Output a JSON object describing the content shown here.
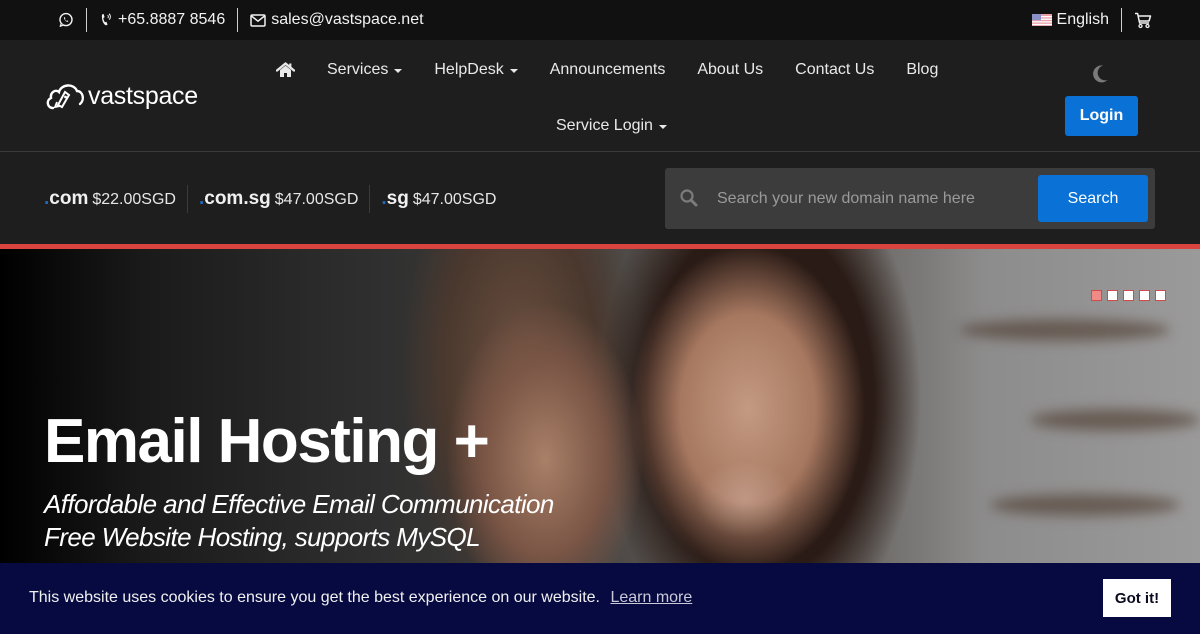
{
  "topbar": {
    "whatsapp_icon": "whatsapp-icon",
    "phone_icon": "phone-volume-icon",
    "phone": "+65.8887 8546",
    "email_icon": "envelope-icon",
    "email": "sales@vastspace.net",
    "language": "English",
    "flag_icon": "us-flag-icon",
    "cart_icon": "shopping-cart-icon"
  },
  "header": {
    "logo_text": "vastspace",
    "logo_icon": "cloud-rocket-icon",
    "nav": [
      {
        "label": "",
        "icon": "home-icon",
        "dropdown": false
      },
      {
        "label": "Services",
        "dropdown": true
      },
      {
        "label": "HelpDesk",
        "dropdown": true
      },
      {
        "label": "Announcements",
        "dropdown": false
      },
      {
        "label": "About Us",
        "dropdown": false
      },
      {
        "label": "Contact Us",
        "dropdown": false
      },
      {
        "label": "Blog",
        "dropdown": false
      },
      {
        "label": "Service Login",
        "dropdown": true
      }
    ],
    "theme_icon": "moon-icon",
    "login_label": "Login"
  },
  "domain": {
    "prices": [
      {
        "tld": "com",
        "price": "$22.00SGD"
      },
      {
        "tld": "com.sg",
        "price": "$47.00SGD"
      },
      {
        "tld": "sg",
        "price": "$47.00SGD"
      }
    ],
    "search_placeholder": "Search your new domain name here",
    "search_value": "",
    "search_label": "Search"
  },
  "hero": {
    "title": "Email Hosting +",
    "subtitle_line1": "Affordable and Effective Email Communication",
    "subtitle_line2": "Free Website Hosting, supports MySQL",
    "slides_total": 5,
    "active_slide": 1
  },
  "cookie": {
    "message": "This website uses cookies to ensure you get the best experience on our website.",
    "link_label": "Learn more",
    "button_label": "Got it!"
  },
  "colors": {
    "accent_blue": "#0a72d6",
    "accent_red": "#d9443f",
    "cookie_bg": "#070a40"
  }
}
